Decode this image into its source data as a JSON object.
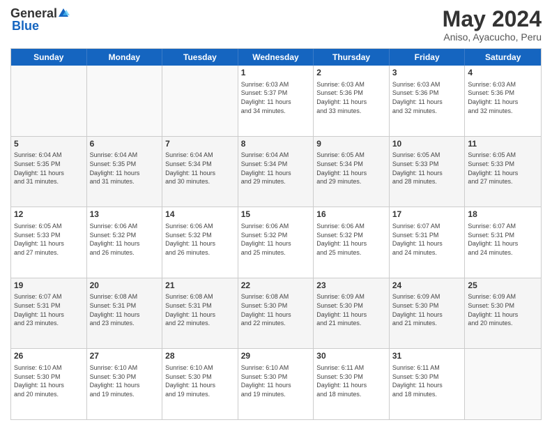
{
  "header": {
    "logo": {
      "general": "General",
      "blue": "Blue"
    },
    "title": "May 2024",
    "location": "Aniso, Ayacucho, Peru"
  },
  "dayHeaders": [
    "Sunday",
    "Monday",
    "Tuesday",
    "Wednesday",
    "Thursday",
    "Friday",
    "Saturday"
  ],
  "weeks": [
    [
      {
        "day": "",
        "info": ""
      },
      {
        "day": "",
        "info": ""
      },
      {
        "day": "",
        "info": ""
      },
      {
        "day": "1",
        "info": "Sunrise: 6:03 AM\nSunset: 5:37 PM\nDaylight: 11 hours\nand 34 minutes."
      },
      {
        "day": "2",
        "info": "Sunrise: 6:03 AM\nSunset: 5:36 PM\nDaylight: 11 hours\nand 33 minutes."
      },
      {
        "day": "3",
        "info": "Sunrise: 6:03 AM\nSunset: 5:36 PM\nDaylight: 11 hours\nand 32 minutes."
      },
      {
        "day": "4",
        "info": "Sunrise: 6:03 AM\nSunset: 5:36 PM\nDaylight: 11 hours\nand 32 minutes."
      }
    ],
    [
      {
        "day": "5",
        "info": "Sunrise: 6:04 AM\nSunset: 5:35 PM\nDaylight: 11 hours\nand 31 minutes."
      },
      {
        "day": "6",
        "info": "Sunrise: 6:04 AM\nSunset: 5:35 PM\nDaylight: 11 hours\nand 31 minutes."
      },
      {
        "day": "7",
        "info": "Sunrise: 6:04 AM\nSunset: 5:34 PM\nDaylight: 11 hours\nand 30 minutes."
      },
      {
        "day": "8",
        "info": "Sunrise: 6:04 AM\nSunset: 5:34 PM\nDaylight: 11 hours\nand 29 minutes."
      },
      {
        "day": "9",
        "info": "Sunrise: 6:05 AM\nSunset: 5:34 PM\nDaylight: 11 hours\nand 29 minutes."
      },
      {
        "day": "10",
        "info": "Sunrise: 6:05 AM\nSunset: 5:33 PM\nDaylight: 11 hours\nand 28 minutes."
      },
      {
        "day": "11",
        "info": "Sunrise: 6:05 AM\nSunset: 5:33 PM\nDaylight: 11 hours\nand 27 minutes."
      }
    ],
    [
      {
        "day": "12",
        "info": "Sunrise: 6:05 AM\nSunset: 5:33 PM\nDaylight: 11 hours\nand 27 minutes."
      },
      {
        "day": "13",
        "info": "Sunrise: 6:06 AM\nSunset: 5:32 PM\nDaylight: 11 hours\nand 26 minutes."
      },
      {
        "day": "14",
        "info": "Sunrise: 6:06 AM\nSunset: 5:32 PM\nDaylight: 11 hours\nand 26 minutes."
      },
      {
        "day": "15",
        "info": "Sunrise: 6:06 AM\nSunset: 5:32 PM\nDaylight: 11 hours\nand 25 minutes."
      },
      {
        "day": "16",
        "info": "Sunrise: 6:06 AM\nSunset: 5:32 PM\nDaylight: 11 hours\nand 25 minutes."
      },
      {
        "day": "17",
        "info": "Sunrise: 6:07 AM\nSunset: 5:31 PM\nDaylight: 11 hours\nand 24 minutes."
      },
      {
        "day": "18",
        "info": "Sunrise: 6:07 AM\nSunset: 5:31 PM\nDaylight: 11 hours\nand 24 minutes."
      }
    ],
    [
      {
        "day": "19",
        "info": "Sunrise: 6:07 AM\nSunset: 5:31 PM\nDaylight: 11 hours\nand 23 minutes."
      },
      {
        "day": "20",
        "info": "Sunrise: 6:08 AM\nSunset: 5:31 PM\nDaylight: 11 hours\nand 23 minutes."
      },
      {
        "day": "21",
        "info": "Sunrise: 6:08 AM\nSunset: 5:31 PM\nDaylight: 11 hours\nand 22 minutes."
      },
      {
        "day": "22",
        "info": "Sunrise: 6:08 AM\nSunset: 5:30 PM\nDaylight: 11 hours\nand 22 minutes."
      },
      {
        "day": "23",
        "info": "Sunrise: 6:09 AM\nSunset: 5:30 PM\nDaylight: 11 hours\nand 21 minutes."
      },
      {
        "day": "24",
        "info": "Sunrise: 6:09 AM\nSunset: 5:30 PM\nDaylight: 11 hours\nand 21 minutes."
      },
      {
        "day": "25",
        "info": "Sunrise: 6:09 AM\nSunset: 5:30 PM\nDaylight: 11 hours\nand 20 minutes."
      }
    ],
    [
      {
        "day": "26",
        "info": "Sunrise: 6:10 AM\nSunset: 5:30 PM\nDaylight: 11 hours\nand 20 minutes."
      },
      {
        "day": "27",
        "info": "Sunrise: 6:10 AM\nSunset: 5:30 PM\nDaylight: 11 hours\nand 19 minutes."
      },
      {
        "day": "28",
        "info": "Sunrise: 6:10 AM\nSunset: 5:30 PM\nDaylight: 11 hours\nand 19 minutes."
      },
      {
        "day": "29",
        "info": "Sunrise: 6:10 AM\nSunset: 5:30 PM\nDaylight: 11 hours\nand 19 minutes."
      },
      {
        "day": "30",
        "info": "Sunrise: 6:11 AM\nSunset: 5:30 PM\nDaylight: 11 hours\nand 18 minutes."
      },
      {
        "day": "31",
        "info": "Sunrise: 6:11 AM\nSunset: 5:30 PM\nDaylight: 11 hours\nand 18 minutes."
      },
      {
        "day": "",
        "info": ""
      }
    ]
  ]
}
